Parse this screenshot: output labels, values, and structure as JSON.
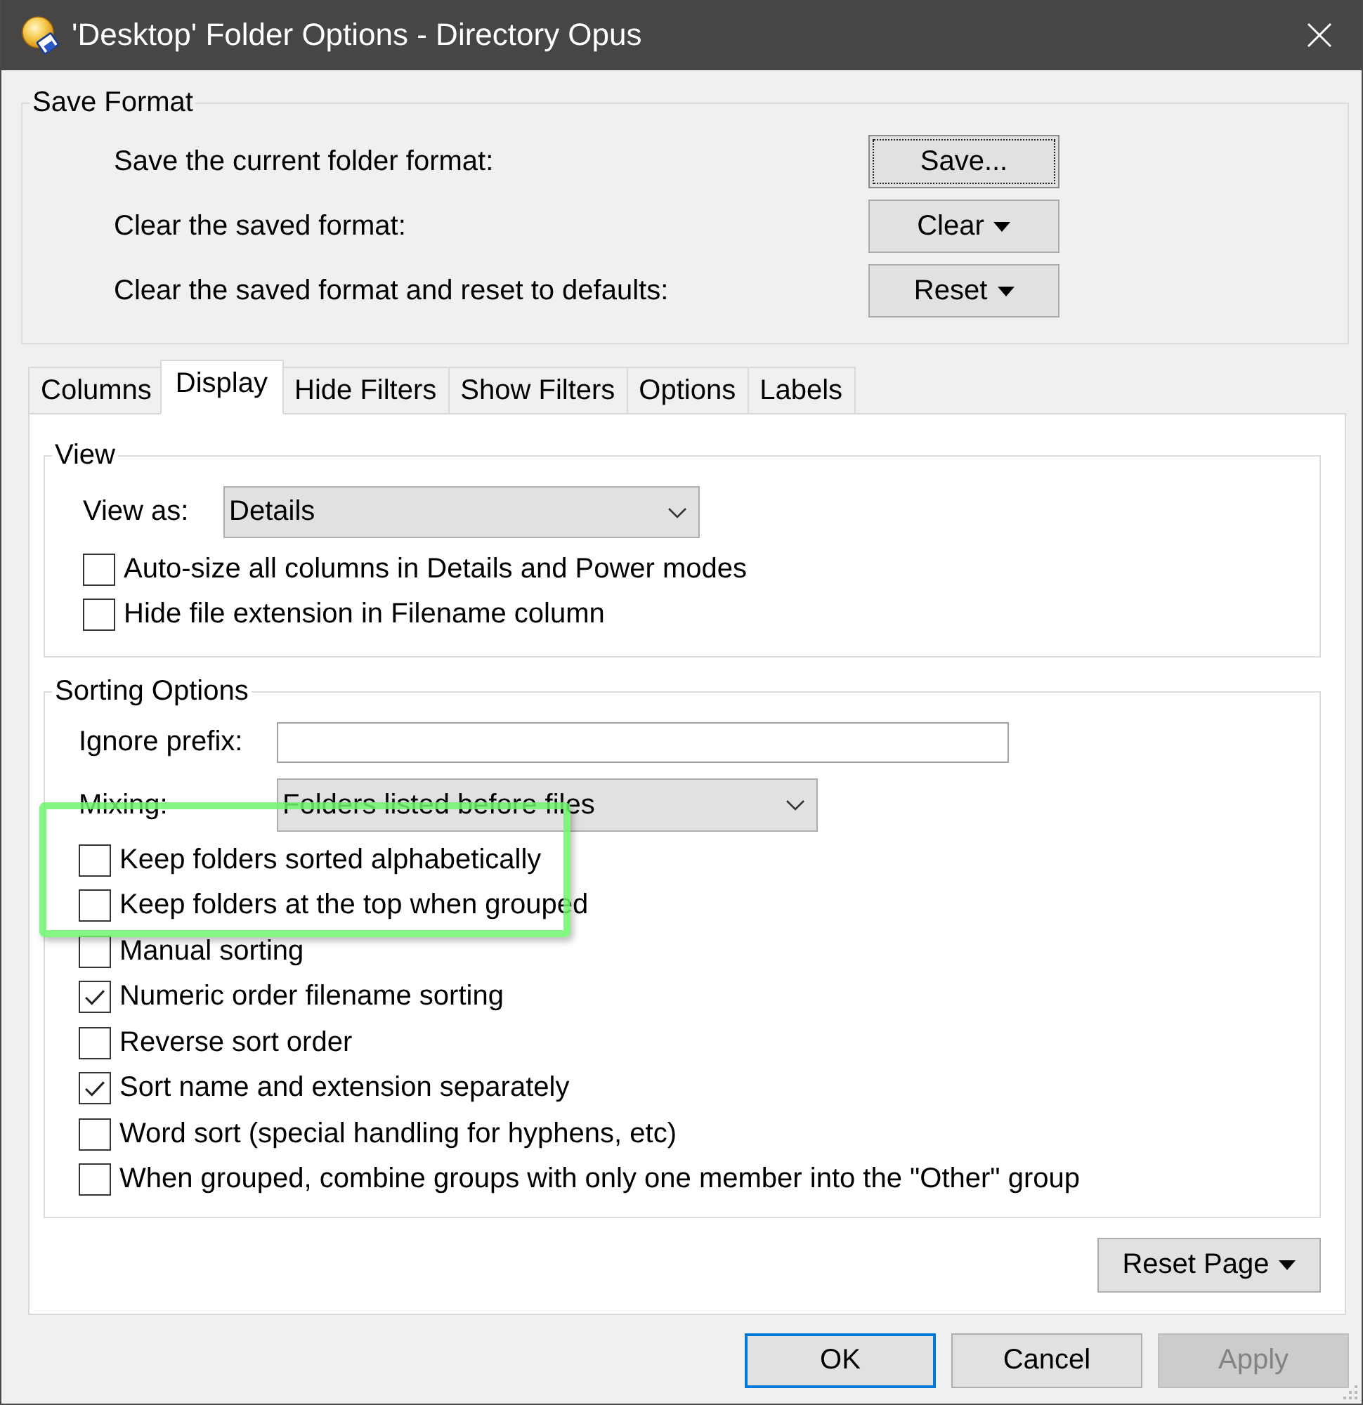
{
  "window": {
    "title": "'Desktop' Folder Options - Directory Opus"
  },
  "save_format": {
    "title": "Save Format",
    "rows": [
      {
        "label": "Save the current folder format:",
        "button": "Save...",
        "menu": false,
        "focused": true
      },
      {
        "label": "Clear the saved format:",
        "button": "Clear",
        "menu": true,
        "focused": false
      },
      {
        "label": "Clear the saved format and reset to defaults:",
        "button": "Reset",
        "menu": true,
        "focused": false
      }
    ]
  },
  "tabs": [
    {
      "label": "Columns",
      "selected": false
    },
    {
      "label": "Display",
      "selected": true
    },
    {
      "label": "Hide Filters",
      "selected": false
    },
    {
      "label": "Show Filters",
      "selected": false
    },
    {
      "label": "Options",
      "selected": false
    },
    {
      "label": "Labels",
      "selected": false
    }
  ],
  "view": {
    "title": "View",
    "view_as": {
      "label": "View as:",
      "value": "Details"
    },
    "options": [
      {
        "label": "Auto-size all columns in Details and Power modes",
        "checked": false
      },
      {
        "label": "Hide file extension in Filename column",
        "checked": false
      }
    ]
  },
  "sorting": {
    "title": "Sorting Options",
    "ignore_prefix": {
      "label": "Ignore prefix:"
    },
    "mixing": {
      "label": "Mixing:",
      "value": "Folders listed before files"
    },
    "options": [
      {
        "kind": "highlight",
        "items": [
          {
            "kind": "checkbox",
            "label": "Keep folders sorted alphabetically",
            "checked": false
          },
          {
            "kind": "checkbox",
            "label": "Keep folders at the top when grouped",
            "checked": false
          }
        ]
      },
      {
        "kind": "checkbox",
        "label": "Manual sorting",
        "checked": false
      },
      {
        "kind": "checkbox",
        "label": "Numeric order filename sorting",
        "checked": true
      },
      {
        "kind": "checkbox",
        "label": "Reverse sort order",
        "checked": false
      },
      {
        "kind": "checkbox",
        "label": "Sort name and extension separately",
        "checked": true
      },
      {
        "kind": "checkbox",
        "label": "Word sort (special handling for hyphens, etc)",
        "checked": false
      },
      {
        "kind": "checkbox",
        "label": "When grouped, combine groups with only one member into the \"Other\" group",
        "checked": false
      }
    ]
  },
  "reset_page": {
    "label": "Reset Page",
    "menu": true
  },
  "buttons": [
    {
      "label": "OK",
      "default": true,
      "disabled": false
    },
    {
      "label": "Cancel",
      "default": false,
      "disabled": false
    },
    {
      "label": "Apply",
      "default": false,
      "disabled": true
    }
  ]
}
